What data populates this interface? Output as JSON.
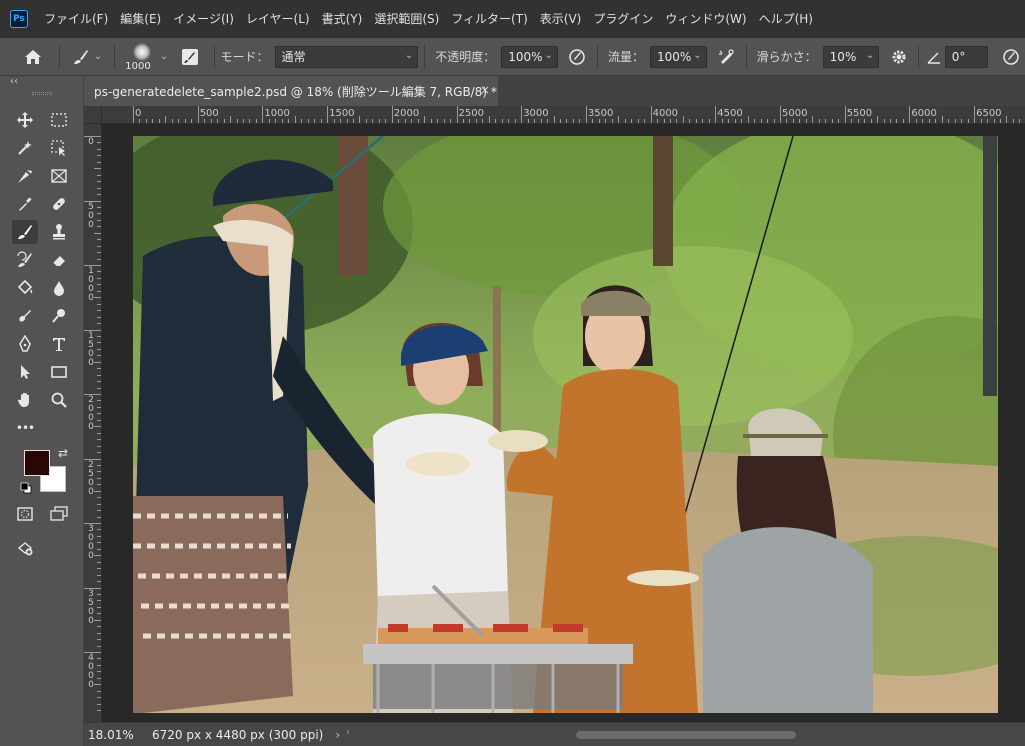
{
  "app": {
    "logo": "Ps"
  },
  "menu": [
    "ファイル(F)",
    "編集(E)",
    "イメージ(I)",
    "レイヤー(L)",
    "書式(Y)",
    "選択範囲(S)",
    "フィルター(T)",
    "表示(V)",
    "プラグイン",
    "ウィンドウ(W)",
    "ヘルプ(H)"
  ],
  "options": {
    "brush_size": "1000",
    "mode_label": "モード：",
    "mode_value": "通常",
    "opacity_label": "不透明度：",
    "opacity_value": "100%",
    "flow_label": "流量：",
    "flow_value": "100%",
    "smoothing_label": "滑らかさ：",
    "smoothing_value": "10%",
    "angle_value": "0°"
  },
  "toolbar": {
    "collapse": "‹‹",
    "more": "•••"
  },
  "document": {
    "tab_title": "ps-generatedelete_sample2.psd @ 18% (削除ツール編集 7, RGB/8) *",
    "close": "×"
  },
  "ruler_h": [
    "0",
    "500",
    "1000",
    "1500",
    "2000",
    "2500",
    "3000",
    "3500",
    "4000",
    "4500",
    "5000",
    "5500",
    "6000",
    "6500"
  ],
  "ruler_v": [
    "0",
    "500",
    "1000",
    "1500",
    "2000",
    "2500",
    "3000",
    "3500",
    "4000"
  ],
  "status": {
    "zoom": "18.01%",
    "doc_info": "6720 px x 4480 px (300 ppi)",
    "more": "›"
  },
  "colors": {
    "foreground": "#2a0606",
    "background": "#ffffff",
    "accent": "#31a8ff"
  },
  "icons": {
    "home": "home-icon",
    "brush": "brush-icon",
    "brush_settings": "brush-settings-icon",
    "airbrush": "airbrush-icon",
    "pressure": "pressure-icon",
    "gear": "gear-icon",
    "angle": "angle-icon",
    "symmetry": "symmetry-icon"
  }
}
